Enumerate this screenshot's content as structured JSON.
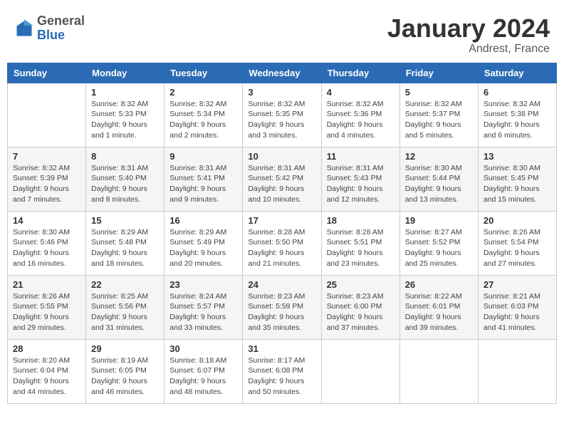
{
  "logo": {
    "line1": "General",
    "line2": "Blue"
  },
  "title": "January 2024",
  "location": "Andrest, France",
  "weekdays": [
    "Sunday",
    "Monday",
    "Tuesday",
    "Wednesday",
    "Thursday",
    "Friday",
    "Saturday"
  ],
  "rows": [
    [
      {
        "day": "",
        "sunrise": "",
        "sunset": "",
        "daylight": ""
      },
      {
        "day": "1",
        "sunrise": "Sunrise: 8:32 AM",
        "sunset": "Sunset: 5:33 PM",
        "daylight": "Daylight: 9 hours and 1 minute."
      },
      {
        "day": "2",
        "sunrise": "Sunrise: 8:32 AM",
        "sunset": "Sunset: 5:34 PM",
        "daylight": "Daylight: 9 hours and 2 minutes."
      },
      {
        "day": "3",
        "sunrise": "Sunrise: 8:32 AM",
        "sunset": "Sunset: 5:35 PM",
        "daylight": "Daylight: 9 hours and 3 minutes."
      },
      {
        "day": "4",
        "sunrise": "Sunrise: 8:32 AM",
        "sunset": "Sunset: 5:36 PM",
        "daylight": "Daylight: 9 hours and 4 minutes."
      },
      {
        "day": "5",
        "sunrise": "Sunrise: 8:32 AM",
        "sunset": "Sunset: 5:37 PM",
        "daylight": "Daylight: 9 hours and 5 minutes."
      },
      {
        "day": "6",
        "sunrise": "Sunrise: 8:32 AM",
        "sunset": "Sunset: 5:38 PM",
        "daylight": "Daylight: 9 hours and 6 minutes."
      }
    ],
    [
      {
        "day": "7",
        "sunrise": "Sunrise: 8:32 AM",
        "sunset": "Sunset: 5:39 PM",
        "daylight": "Daylight: 9 hours and 7 minutes."
      },
      {
        "day": "8",
        "sunrise": "Sunrise: 8:31 AM",
        "sunset": "Sunset: 5:40 PM",
        "daylight": "Daylight: 9 hours and 8 minutes."
      },
      {
        "day": "9",
        "sunrise": "Sunrise: 8:31 AM",
        "sunset": "Sunset: 5:41 PM",
        "daylight": "Daylight: 9 hours and 9 minutes."
      },
      {
        "day": "10",
        "sunrise": "Sunrise: 8:31 AM",
        "sunset": "Sunset: 5:42 PM",
        "daylight": "Daylight: 9 hours and 10 minutes."
      },
      {
        "day": "11",
        "sunrise": "Sunrise: 8:31 AM",
        "sunset": "Sunset: 5:43 PM",
        "daylight": "Daylight: 9 hours and 12 minutes."
      },
      {
        "day": "12",
        "sunrise": "Sunrise: 8:30 AM",
        "sunset": "Sunset: 5:44 PM",
        "daylight": "Daylight: 9 hours and 13 minutes."
      },
      {
        "day": "13",
        "sunrise": "Sunrise: 8:30 AM",
        "sunset": "Sunset: 5:45 PM",
        "daylight": "Daylight: 9 hours and 15 minutes."
      }
    ],
    [
      {
        "day": "14",
        "sunrise": "Sunrise: 8:30 AM",
        "sunset": "Sunset: 5:46 PM",
        "daylight": "Daylight: 9 hours and 16 minutes."
      },
      {
        "day": "15",
        "sunrise": "Sunrise: 8:29 AM",
        "sunset": "Sunset: 5:48 PM",
        "daylight": "Daylight: 9 hours and 18 minutes."
      },
      {
        "day": "16",
        "sunrise": "Sunrise: 8:29 AM",
        "sunset": "Sunset: 5:49 PM",
        "daylight": "Daylight: 9 hours and 20 minutes."
      },
      {
        "day": "17",
        "sunrise": "Sunrise: 8:28 AM",
        "sunset": "Sunset: 5:50 PM",
        "daylight": "Daylight: 9 hours and 21 minutes."
      },
      {
        "day": "18",
        "sunrise": "Sunrise: 8:28 AM",
        "sunset": "Sunset: 5:51 PM",
        "daylight": "Daylight: 9 hours and 23 minutes."
      },
      {
        "day": "19",
        "sunrise": "Sunrise: 8:27 AM",
        "sunset": "Sunset: 5:52 PM",
        "daylight": "Daylight: 9 hours and 25 minutes."
      },
      {
        "day": "20",
        "sunrise": "Sunrise: 8:26 AM",
        "sunset": "Sunset: 5:54 PM",
        "daylight": "Daylight: 9 hours and 27 minutes."
      }
    ],
    [
      {
        "day": "21",
        "sunrise": "Sunrise: 8:26 AM",
        "sunset": "Sunset: 5:55 PM",
        "daylight": "Daylight: 9 hours and 29 minutes."
      },
      {
        "day": "22",
        "sunrise": "Sunrise: 8:25 AM",
        "sunset": "Sunset: 5:56 PM",
        "daylight": "Daylight: 9 hours and 31 minutes."
      },
      {
        "day": "23",
        "sunrise": "Sunrise: 8:24 AM",
        "sunset": "Sunset: 5:57 PM",
        "daylight": "Daylight: 9 hours and 33 minutes."
      },
      {
        "day": "24",
        "sunrise": "Sunrise: 8:23 AM",
        "sunset": "Sunset: 5:59 PM",
        "daylight": "Daylight: 9 hours and 35 minutes."
      },
      {
        "day": "25",
        "sunrise": "Sunrise: 8:23 AM",
        "sunset": "Sunset: 6:00 PM",
        "daylight": "Daylight: 9 hours and 37 minutes."
      },
      {
        "day": "26",
        "sunrise": "Sunrise: 8:22 AM",
        "sunset": "Sunset: 6:01 PM",
        "daylight": "Daylight: 9 hours and 39 minutes."
      },
      {
        "day": "27",
        "sunrise": "Sunrise: 8:21 AM",
        "sunset": "Sunset: 6:03 PM",
        "daylight": "Daylight: 9 hours and 41 minutes."
      }
    ],
    [
      {
        "day": "28",
        "sunrise": "Sunrise: 8:20 AM",
        "sunset": "Sunset: 6:04 PM",
        "daylight": "Daylight: 9 hours and 44 minutes."
      },
      {
        "day": "29",
        "sunrise": "Sunrise: 8:19 AM",
        "sunset": "Sunset: 6:05 PM",
        "daylight": "Daylight: 9 hours and 46 minutes."
      },
      {
        "day": "30",
        "sunrise": "Sunrise: 8:18 AM",
        "sunset": "Sunset: 6:07 PM",
        "daylight": "Daylight: 9 hours and 48 minutes."
      },
      {
        "day": "31",
        "sunrise": "Sunrise: 8:17 AM",
        "sunset": "Sunset: 6:08 PM",
        "daylight": "Daylight: 9 hours and 50 minutes."
      },
      {
        "day": "",
        "sunrise": "",
        "sunset": "",
        "daylight": ""
      },
      {
        "day": "",
        "sunrise": "",
        "sunset": "",
        "daylight": ""
      },
      {
        "day": "",
        "sunrise": "",
        "sunset": "",
        "daylight": ""
      }
    ]
  ]
}
